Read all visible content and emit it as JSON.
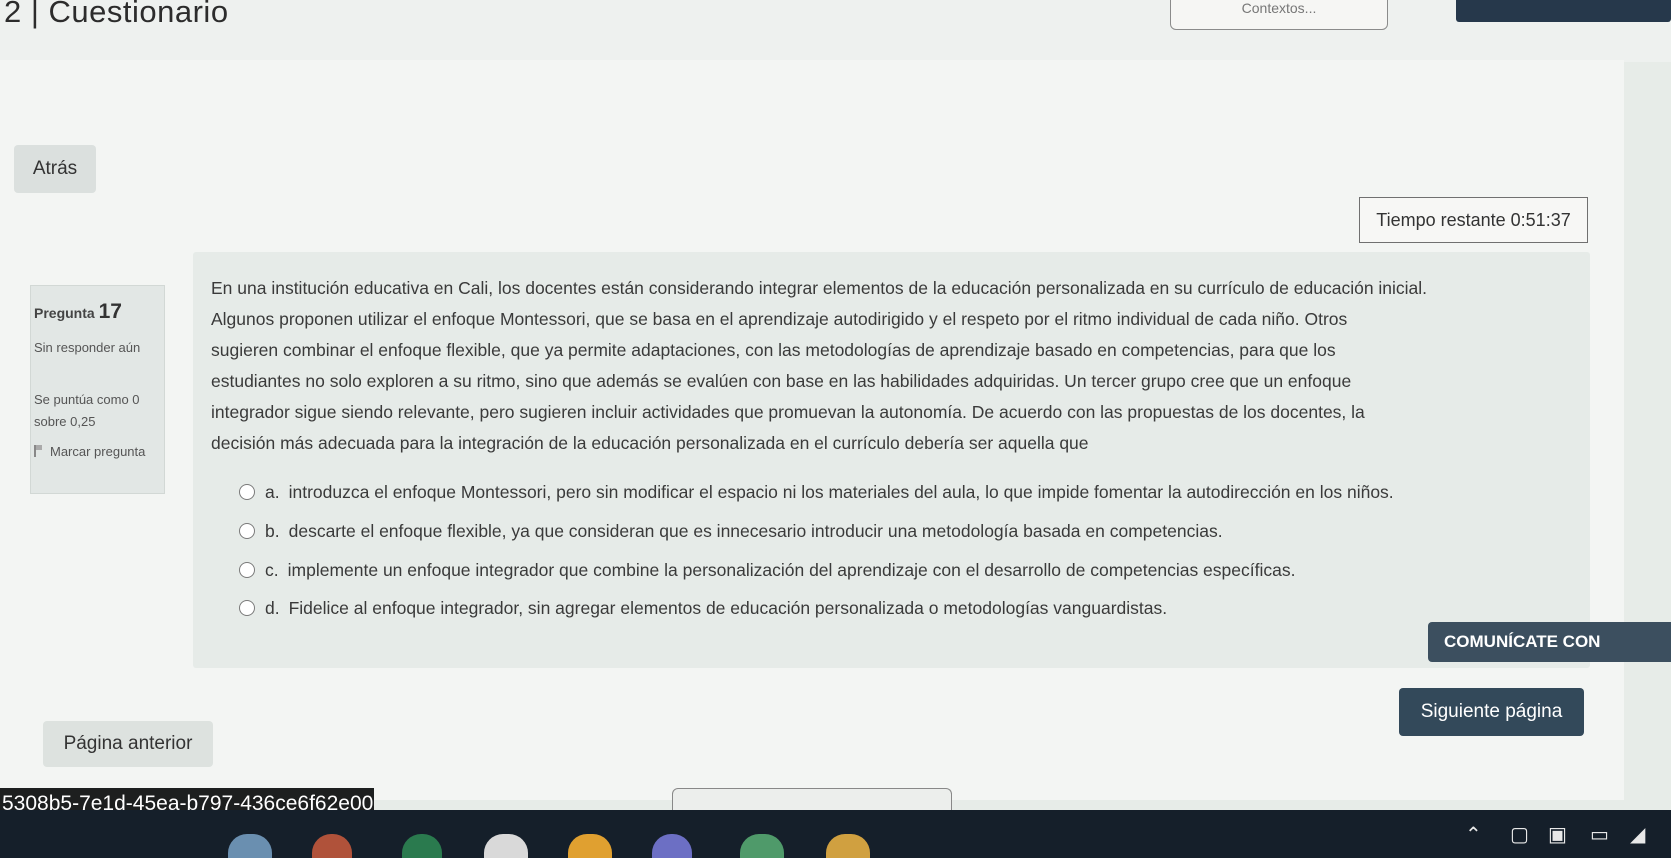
{
  "header": {
    "title": "2 | Cuestionario",
    "contexts_button": "Contextos..."
  },
  "nav": {
    "back_label": "Atrás"
  },
  "timer": {
    "label": "Tiempo restante 0:51:37"
  },
  "question": {
    "label": "Pregunta",
    "number": "17",
    "status": "Sin responder aún",
    "score": "Se puntúa como 0 sobre 0,25",
    "flag_label": "Marcar pregunta",
    "text": "En una institución educativa en Cali, los docentes están considerando integrar elementos de la educación personalizada en su currículo de educación inicial.\nAlgunos proponen utilizar el enfoque Montessori, que se basa en el aprendizaje autodirigido y el respeto por el ritmo individual de cada niño. Otros\nsugieren combinar el enfoque flexible, que ya permite adaptaciones, con las metodologías de aprendizaje basado en competencias, para que los\nestudiantes no solo exploren a su ritmo, sino que además se evalúen con base en las habilidades adquiridas. Un tercer grupo cree que un enfoque\nintegrador sigue siendo relevante, pero sugieren incluir actividades que promuevan la autonomía. De acuerdo con las propuestas de los docentes, la\ndecisión más adecuada para la integración de la educación personalizada en el currículo debería ser aquella que",
    "options": [
      {
        "letter": "a.",
        "text": "introduzca el enfoque Montessori, pero sin modificar el espacio ni los materiales del aula, lo que impide fomentar la autodirección en los niños."
      },
      {
        "letter": "b.",
        "text": "descarte el enfoque flexible, ya que consideran que es innecesario introducir una metodología basada en competencias."
      },
      {
        "letter": "c.",
        "text": "implemente un enfoque integrador que combine la personalización del aprendizaje con el desarrollo de competencias específicas."
      },
      {
        "letter": "d.",
        "text": "Fidelice al enfoque integrador, sin agregar elementos de educación personalizada o metodologías vanguardistas."
      }
    ]
  },
  "chat_button": "COMUNÍCATE CON",
  "footer": {
    "prev_label": "Página anterior",
    "next_label": "Siguiente página",
    "session_id": "5308b5-7e1d-45ea-b797-436ce6f62e00"
  },
  "taskbar": {
    "icons": [
      "taskbar-app-1-icon",
      "taskbar-app-2-icon",
      "excel-icon",
      "chrome-icon",
      "chrome-2-icon",
      "teams-icon",
      "chrome-3-icon",
      "chrome-4-icon"
    ],
    "tray": [
      "chevron-up-icon",
      "network-icon",
      "language-icon",
      "battery-icon",
      "wifi-icon"
    ],
    "colors": {
      "bar": "#151f2a"
    }
  },
  "colors": {
    "accent_dark": "#33495a",
    "background": "#e7ece8"
  }
}
